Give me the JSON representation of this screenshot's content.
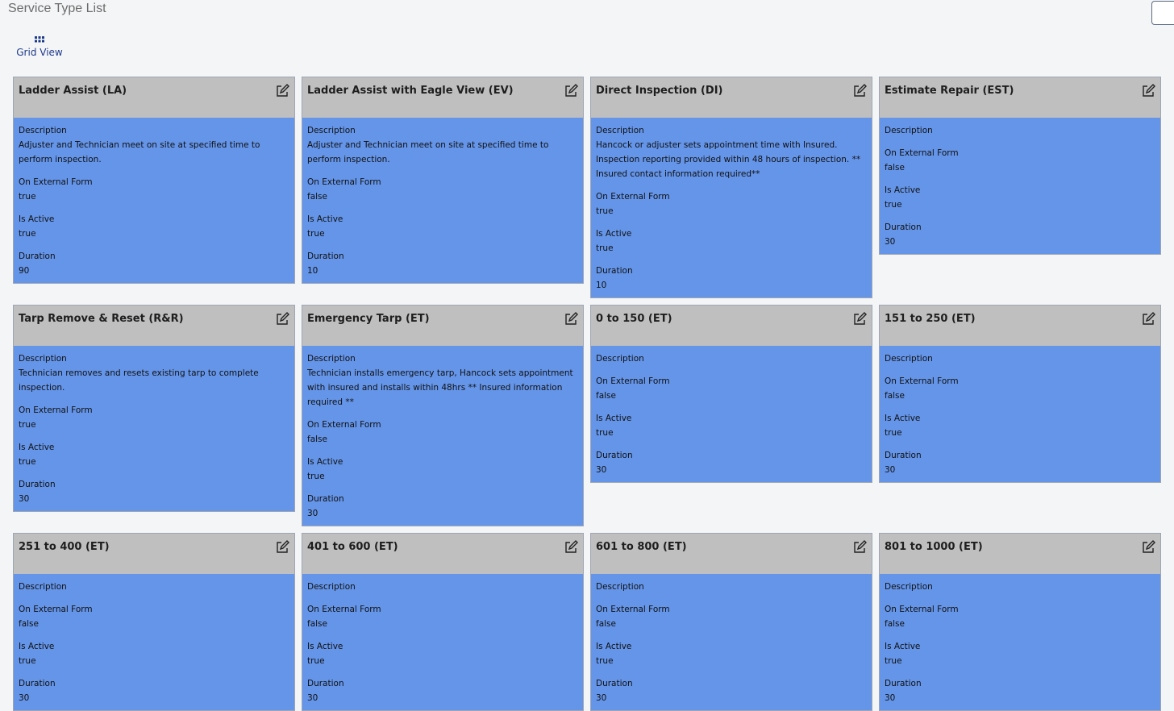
{
  "page": {
    "title": "Service Type List",
    "grid_view_label": "Grid View",
    "grid_view_icon": "grid-dots-icon"
  },
  "labels": {
    "description": "Description",
    "on_external_form": "On External Form",
    "is_active": "Is Active",
    "duration": "Duration"
  },
  "colors": {
    "card_header": "#bfbfbf",
    "card_body": "#6595e8",
    "accent": "#1d3a8a"
  },
  "cards": [
    {
      "title": "Ladder Assist (LA)",
      "description": "Adjuster and Technician meet on site at specified time to perform inspection.",
      "on_external_form": "true",
      "is_active": "true",
      "duration": "90"
    },
    {
      "title": "Ladder Assist with Eagle View (EV)",
      "description": "Adjuster and Technician meet on site at specified time to perform inspection.",
      "on_external_form": "false",
      "is_active": "true",
      "duration": "10"
    },
    {
      "title": "Direct Inspection (DI)",
      "description": "Hancock or adjuster sets appointment time with Insured. Inspection reporting provided within 48 hours of inspection. ** Insured contact information required**",
      "on_external_form": "true",
      "is_active": "true",
      "duration": "10"
    },
    {
      "title": "Estimate Repair (EST)",
      "description": "",
      "on_external_form": "false",
      "is_active": "true",
      "duration": "30"
    },
    {
      "title": "Tarp Remove & Reset (R&R)",
      "description": "Technician removes and resets existing tarp to complete inspection.",
      "on_external_form": "true",
      "is_active": "true",
      "duration": "30"
    },
    {
      "title": "Emergency Tarp (ET)",
      "description": "Technician installs emergency tarp, Hancock sets appointment with insured and installs within 48hrs ** Insured information required **",
      "on_external_form": "false",
      "is_active": "true",
      "duration": "30"
    },
    {
      "title": "0 to 150 (ET)",
      "description": "",
      "on_external_form": "false",
      "is_active": "true",
      "duration": "30"
    },
    {
      "title": "151 to 250 (ET)",
      "description": "",
      "on_external_form": "false",
      "is_active": "true",
      "duration": "30"
    },
    {
      "title": "251 to 400 (ET)",
      "description": "",
      "on_external_form": "false",
      "is_active": "true",
      "duration": "30"
    },
    {
      "title": "401 to 600 (ET)",
      "description": "",
      "on_external_form": "false",
      "is_active": "true",
      "duration": "30"
    },
    {
      "title": "601 to 800 (ET)",
      "description": "",
      "on_external_form": "false",
      "is_active": "true",
      "duration": "30"
    },
    {
      "title": "801 to 1000 (ET)",
      "description": "",
      "on_external_form": "false",
      "is_active": "true",
      "duration": "30"
    }
  ]
}
